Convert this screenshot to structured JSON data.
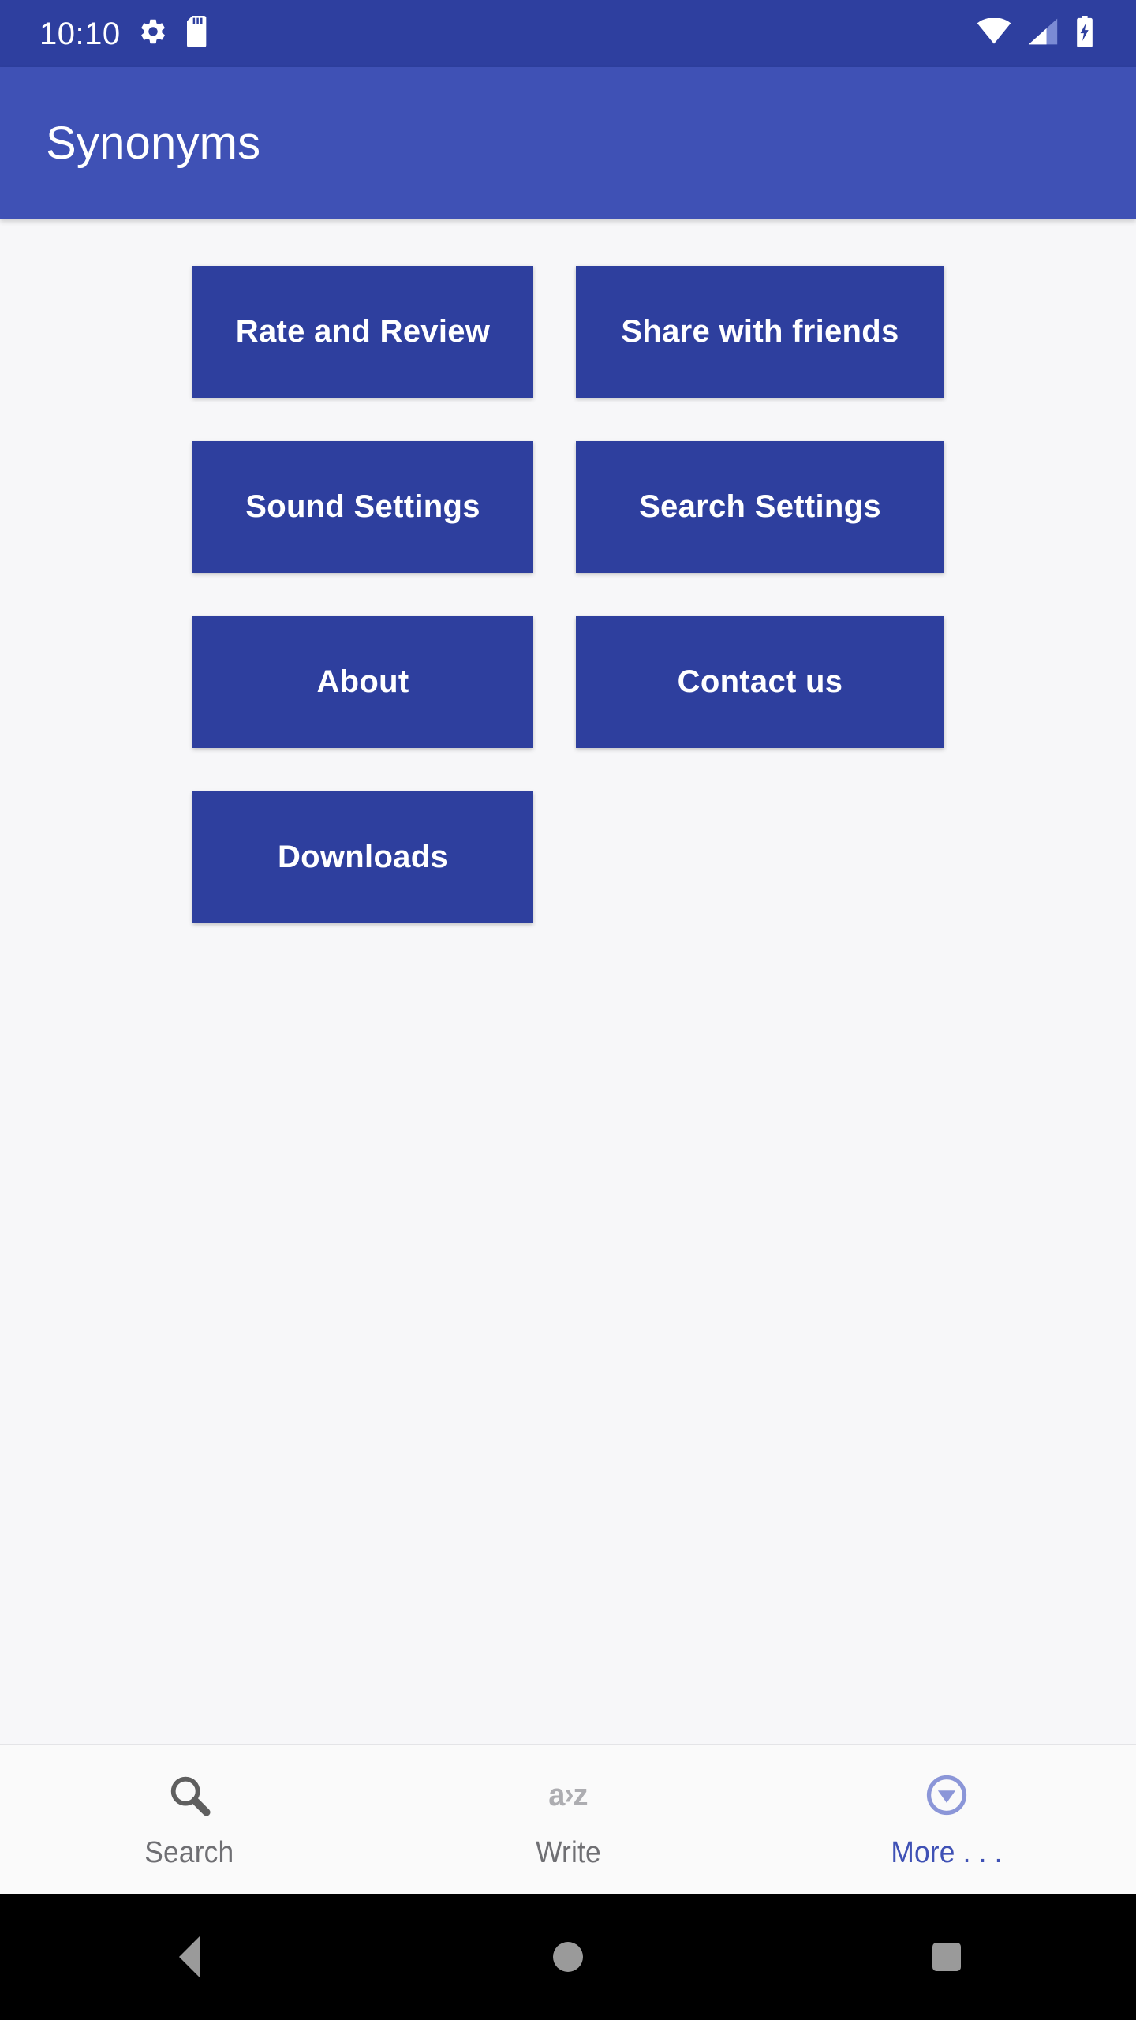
{
  "status_bar": {
    "time": "10:10",
    "left_icons": [
      "gear-icon",
      "sd-card-icon"
    ],
    "right_icons": [
      "wifi-icon",
      "cellular-signal-icon",
      "battery-charging-icon"
    ],
    "background_color": "#2e3f9f"
  },
  "app_bar": {
    "title": "Synonyms",
    "background_color": "#3f51b5",
    "text_color": "#ffffff"
  },
  "main": {
    "background_color": "#f7f7f9",
    "button_color": "#2e3f9e",
    "button_text_color": "#ffffff",
    "buttons": [
      {
        "label": "Rate and Review"
      },
      {
        "label": "Share with friends"
      },
      {
        "label": "Sound Settings"
      },
      {
        "label": "Search Settings"
      },
      {
        "label": "About"
      },
      {
        "label": "Contact us"
      },
      {
        "label": "Downloads"
      }
    ]
  },
  "bottom_nav": {
    "background_color": "#fafafa",
    "inactive_color": "#6f6f73",
    "active_color": "#3f51b5",
    "items": [
      {
        "label": "Search",
        "icon": "search-icon",
        "active": false
      },
      {
        "label": "Write",
        "icon": "a-to-z-icon",
        "active": false,
        "icon_text_a": "a",
        "icon_text_arrow": "›",
        "icon_text_z": "z"
      },
      {
        "label": "More . . .",
        "icon": "circle-chevron-down-icon",
        "active": true
      }
    ]
  },
  "system_nav": {
    "background_color": "#000000",
    "buttons": [
      {
        "name": "back",
        "icon": "triangle-back-icon"
      },
      {
        "name": "home",
        "icon": "circle-home-icon"
      },
      {
        "name": "recents",
        "icon": "square-recents-icon"
      }
    ]
  }
}
